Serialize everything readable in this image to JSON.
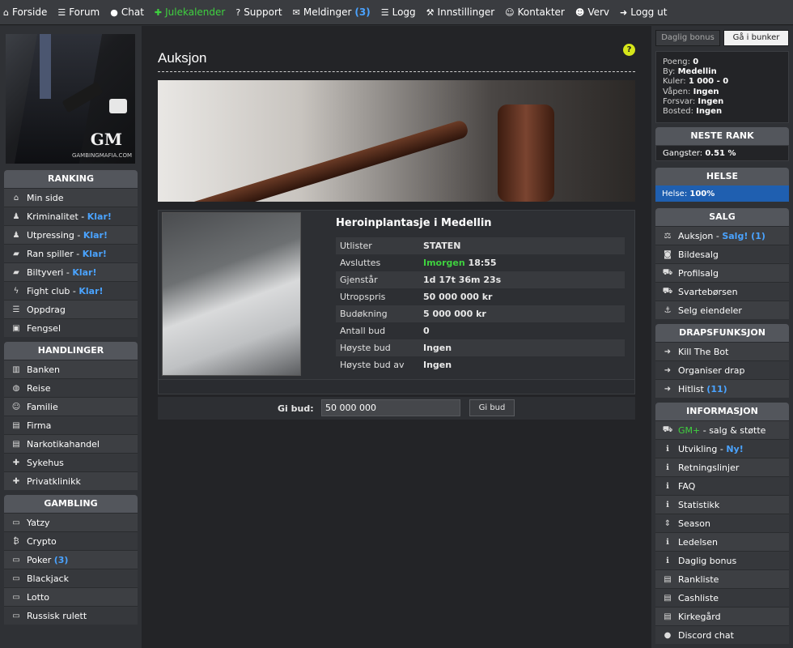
{
  "topnav": [
    {
      "name": "forside",
      "icon": "home-icon",
      "glyph": "⌂",
      "label": "Forside"
    },
    {
      "name": "forum",
      "icon": "list-icon",
      "glyph": "☰",
      "label": "Forum"
    },
    {
      "name": "chat",
      "icon": "chat-icon",
      "glyph": "●",
      "label": "Chat"
    },
    {
      "name": "julekalender",
      "icon": "gift-icon",
      "glyph": "✚",
      "label": "Julekalender",
      "green": true
    },
    {
      "name": "support",
      "icon": "question-icon",
      "glyph": "?",
      "label": "Support"
    },
    {
      "name": "meldinger",
      "icon": "envelope-icon",
      "glyph": "✉",
      "label": "Meldinger",
      "count": "(3)"
    },
    {
      "name": "logg",
      "icon": "list-icon",
      "glyph": "☰",
      "label": "Logg"
    },
    {
      "name": "innstillinger",
      "icon": "wrench-icon",
      "glyph": "⚒",
      "label": "Innstillinger"
    },
    {
      "name": "kontakter",
      "icon": "users-icon",
      "glyph": "☺",
      "label": "Kontakter"
    },
    {
      "name": "verv",
      "icon": "user-plus-icon",
      "glyph": "☻",
      "label": "Verv"
    },
    {
      "name": "logg-ut",
      "icon": "sign-out-icon",
      "glyph": "➜",
      "label": "Logg ut"
    }
  ],
  "avatar": {
    "logo": "GM",
    "site": "GAMBINGMAFIA.COM"
  },
  "left": {
    "ranking": {
      "title": "RANKING",
      "items": [
        {
          "name": "min-side",
          "icon": "home-icon",
          "glyph": "⌂",
          "label": "Min side"
        },
        {
          "name": "kriminalitet",
          "icon": "person-icon",
          "glyph": "♟",
          "label": "Kriminalitet",
          "suffix": "Klar!"
        },
        {
          "name": "utpressing",
          "icon": "person-icon",
          "glyph": "♟",
          "label": "Utpressing",
          "suffix": "Klar!"
        },
        {
          "name": "ran-spiller",
          "icon": "car-icon",
          "glyph": "▰",
          "label": "Ran spiller",
          "suffix": "Klar!"
        },
        {
          "name": "biltyveri",
          "icon": "car-icon",
          "glyph": "▰",
          "label": "Biltyveri",
          "suffix": "Klar!"
        },
        {
          "name": "fight-club",
          "icon": "bolt-icon",
          "glyph": "ϟ",
          "label": "Fight club",
          "suffix": "Klar!"
        },
        {
          "name": "oppdrag",
          "icon": "list-icon",
          "glyph": "☰",
          "label": "Oppdrag"
        },
        {
          "name": "fengsel",
          "icon": "lock-icon",
          "glyph": "▣",
          "label": "Fengsel"
        }
      ]
    },
    "handlinger": {
      "title": "HANDLINGER",
      "items": [
        {
          "name": "banken",
          "icon": "bank-icon",
          "glyph": "▥",
          "label": "Banken"
        },
        {
          "name": "reise",
          "icon": "globe-icon",
          "glyph": "◍",
          "label": "Reise"
        },
        {
          "name": "familie",
          "icon": "users-icon",
          "glyph": "☺",
          "label": "Familie"
        },
        {
          "name": "firma",
          "icon": "building-icon",
          "glyph": "▤",
          "label": "Firma"
        },
        {
          "name": "narkotikahandel",
          "icon": "building-icon",
          "glyph": "▤",
          "label": "Narkotikahandel"
        },
        {
          "name": "sykehus",
          "icon": "hospital-icon",
          "glyph": "✚",
          "label": "Sykehus"
        },
        {
          "name": "privatklinikk",
          "icon": "medkit-icon",
          "glyph": "✚",
          "label": "Privatklinikk"
        }
      ]
    },
    "gambling": {
      "title": "GAMBLING",
      "items": [
        {
          "name": "yatzy",
          "icon": "money-icon",
          "glyph": "▭",
          "label": "Yatzy"
        },
        {
          "name": "crypto",
          "icon": "bitcoin-icon",
          "glyph": "₿",
          "label": "Crypto"
        },
        {
          "name": "poker",
          "icon": "money-icon",
          "glyph": "▭",
          "label": "Poker",
          "count": "(3)"
        },
        {
          "name": "blackjack",
          "icon": "money-icon",
          "glyph": "▭",
          "label": "Blackjack"
        },
        {
          "name": "lotto",
          "icon": "money-icon",
          "glyph": "▭",
          "label": "Lotto"
        },
        {
          "name": "russisk-rulett",
          "icon": "money-icon",
          "glyph": "▭",
          "label": "Russisk rulett"
        }
      ]
    }
  },
  "main": {
    "title": "Auksjon",
    "help": "?",
    "item_name": "Heroinplantasje i Medellin",
    "rows": [
      {
        "key": "Utlister",
        "value": "STATEN",
        "style": "yellow"
      },
      {
        "key": "Avsluttes",
        "value_green": "Imorgen",
        "value": "18:55"
      },
      {
        "key": "Gjenstår",
        "value": "1d 17t 36m 23s"
      },
      {
        "key": "Utropspris",
        "value": "50 000 000 kr"
      },
      {
        "key": "Budøkning",
        "value": "5 000 000 kr"
      },
      {
        "key": "Antall bud",
        "value": "0"
      },
      {
        "key": "Høyste bud",
        "value": "Ingen",
        "style": "red"
      },
      {
        "key": "Høyste bud av",
        "value": "Ingen",
        "style": "red"
      }
    ],
    "bid_label": "Gi bud:",
    "bid_value": "50 000 000",
    "bid_button": "Gi bud"
  },
  "right": {
    "daglig_bonus_btn": "Daglig bonus",
    "bunker_btn": "Gå i bunker",
    "stats": [
      {
        "key": "Poeng:",
        "value": "0"
      },
      {
        "key": "By:",
        "value": "Medellin"
      },
      {
        "key": "Kuler:",
        "value": "1 000 - 0"
      },
      {
        "key": "Våpen:",
        "value": "Ingen"
      },
      {
        "key": "Forsvar:",
        "value": "Ingen"
      },
      {
        "key": "Bosted:",
        "value": "Ingen"
      }
    ],
    "neste_rank": {
      "title": "NESTE RANK",
      "label": "Gangster:",
      "value": "0.51 %"
    },
    "helse": {
      "title": "HELSE",
      "label": "Helse:",
      "value": "100%",
      "fraction": 1.0
    },
    "salg": {
      "title": "SALG",
      "items": [
        {
          "name": "auksjon",
          "icon": "gavel-icon",
          "glyph": "⚖",
          "label": "Auksjon",
          "suffix": "Salg! (1)"
        },
        {
          "name": "bildesalg",
          "icon": "camera-icon",
          "glyph": "◙",
          "label": "Bildesalg"
        },
        {
          "name": "profilsalg",
          "icon": "cart-icon",
          "glyph": "⛟",
          "label": "Profilsalg"
        },
        {
          "name": "svartebørsen",
          "icon": "cart-icon",
          "glyph": "⛟",
          "label": "Svartebørsen"
        },
        {
          "name": "selg-eiendeler",
          "icon": "anchor-icon",
          "glyph": "⚓",
          "label": "Selg eiendeler"
        }
      ]
    },
    "drap": {
      "title": "DRAPSFUNKSJON",
      "items": [
        {
          "name": "kill-the-bot",
          "icon": "arrow-right-icon",
          "glyph": "➜",
          "label": "Kill The Bot"
        },
        {
          "name": "organiser-drap",
          "icon": "arrow-right-icon",
          "glyph": "➜",
          "label": "Organiser drap"
        },
        {
          "name": "hitlist",
          "icon": "arrow-right-icon",
          "glyph": "➜",
          "label": "Hitlist",
          "count": "(11)"
        }
      ]
    },
    "info": {
      "title": "INFORMASJON",
      "items": [
        {
          "name": "gm-plus",
          "icon": "cart-icon",
          "glyph": "⛟",
          "label_green": "GM+",
          "label": "- salg & støtte"
        },
        {
          "name": "utvikling",
          "icon": "info-icon",
          "glyph": "ℹ",
          "label": "Utvikling",
          "suffix": "Ny!"
        },
        {
          "name": "retningslinjer",
          "icon": "info-icon",
          "glyph": "ℹ",
          "label": "Retningslinjer"
        },
        {
          "name": "faq",
          "icon": "info-icon",
          "glyph": "ℹ",
          "label": "FAQ"
        },
        {
          "name": "statistikk",
          "icon": "info-icon",
          "glyph": "ℹ",
          "label": "Statistikk"
        },
        {
          "name": "season",
          "icon": "sort-icon",
          "glyph": "⇕",
          "label": "Season"
        },
        {
          "name": "ledelsen",
          "icon": "info-icon",
          "glyph": "ℹ",
          "label": "Ledelsen"
        },
        {
          "name": "daglig-bonus",
          "icon": "info-icon",
          "glyph": "ℹ",
          "label": "Daglig bonus"
        },
        {
          "name": "rankliste",
          "icon": "list-icon",
          "glyph": "▤",
          "label": "Rankliste"
        },
        {
          "name": "cashliste",
          "icon": "list-icon",
          "glyph": "▤",
          "label": "Cashliste"
        },
        {
          "name": "kirkegard",
          "icon": "list-icon",
          "glyph": "▤",
          "label": "Kirkegård"
        },
        {
          "name": "discord-chat",
          "icon": "chat-icon",
          "glyph": "●",
          "label": "Discord chat"
        }
      ]
    }
  }
}
